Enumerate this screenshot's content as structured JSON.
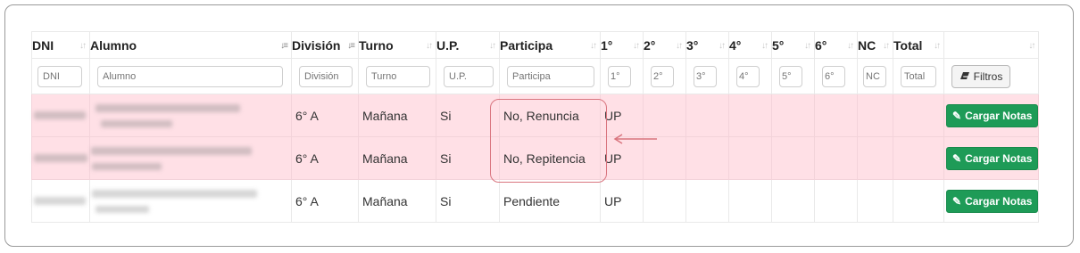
{
  "columns": [
    {
      "label": "DNI",
      "placeholder": "DNI"
    },
    {
      "label": "Alumno",
      "placeholder": "Alumno"
    },
    {
      "label": "División",
      "placeholder": "División"
    },
    {
      "label": "Turno",
      "placeholder": "Turno"
    },
    {
      "label": "U.P.",
      "placeholder": "U.P."
    },
    {
      "label": "Participa",
      "placeholder": "Participa"
    },
    {
      "label": "1°",
      "placeholder": "1°"
    },
    {
      "label": "2°",
      "placeholder": "2°"
    },
    {
      "label": "3°",
      "placeholder": "3°"
    },
    {
      "label": "4°",
      "placeholder": "4°"
    },
    {
      "label": "5°",
      "placeholder": "5°"
    },
    {
      "label": "6°",
      "placeholder": "6°"
    },
    {
      "label": "NC",
      "placeholder": "NC"
    },
    {
      "label": "Total",
      "placeholder": "Total"
    }
  ],
  "filters_button": {
    "label": "Filtros",
    "icon": "eraser-icon"
  },
  "rows": [
    {
      "division": "6° A",
      "turno": "Mañana",
      "up": "Si",
      "participa": "No, Renuncia",
      "grade1": "UP",
      "action": "Cargar Notas",
      "highlight": true
    },
    {
      "division": "6° A",
      "turno": "Mañana",
      "up": "Si",
      "participa": "No, Repitencia",
      "grade1": "UP",
      "action": "Cargar Notas",
      "highlight": true
    },
    {
      "division": "6° A",
      "turno": "Mañana",
      "up": "Si",
      "participa": "Pendiente",
      "grade1": "UP",
      "action": "Cargar Notas",
      "highlight": false
    }
  ],
  "colors": {
    "highlight_row": "#ffe0e6",
    "action_button": "#1e9b57",
    "annotation": "#d9757f"
  }
}
